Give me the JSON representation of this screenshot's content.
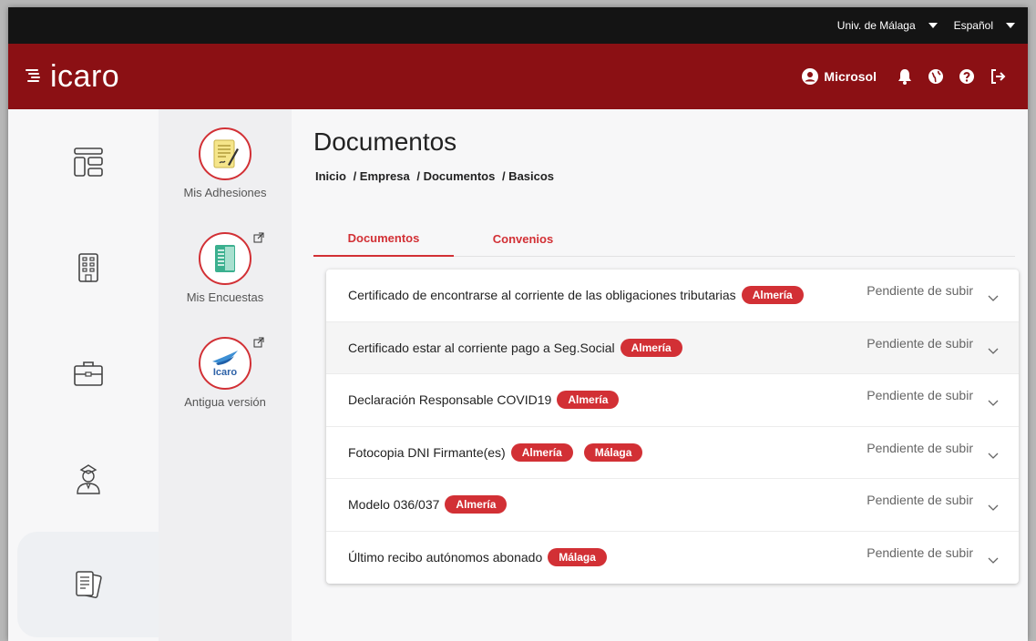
{
  "topbar": {
    "university": "Univ. de Málaga",
    "language": "Español"
  },
  "brand": {
    "logo_text": "icaro",
    "user": "Microsol"
  },
  "subnav": [
    {
      "label": "Mis Adhesiones"
    },
    {
      "label": "Mis Encuestas"
    },
    {
      "label": "Antigua versión",
      "badge": "Icaro"
    }
  ],
  "page": {
    "title": "Documentos",
    "breadcrumb": [
      "Inicio",
      "/ Empresa",
      "/ Documentos",
      "/ Basicos"
    ],
    "tabs": [
      "Documentos",
      "Convenios"
    ]
  },
  "documents": [
    {
      "title": "Certificado de encontrarse al corriente de las obligaciones tributarias",
      "tags": [
        "Almería"
      ],
      "status": "Pendiente de subir"
    },
    {
      "title": "Certificado estar al corriente pago a Seg.Social",
      "tags": [
        "Almería"
      ],
      "status": "Pendiente de subir"
    },
    {
      "title": "Declaración Responsable COVID19",
      "tags": [
        "Almería"
      ],
      "status": "Pendiente de subir"
    },
    {
      "title": "Fotocopia DNI Firmante(es)",
      "tags": [
        "Almería",
        "Málaga"
      ],
      "status": "Pendiente de subir"
    },
    {
      "title": "Modelo 036/037",
      "tags": [
        "Almería"
      ],
      "status": "Pendiente de subir"
    },
    {
      "title": "Último recibo autónomos abonado",
      "tags": [
        "Málaga"
      ],
      "status": "Pendiente de subir"
    }
  ],
  "colors": {
    "brand": "#8b1014",
    "accent": "#d23035",
    "topbar": "#141414"
  }
}
